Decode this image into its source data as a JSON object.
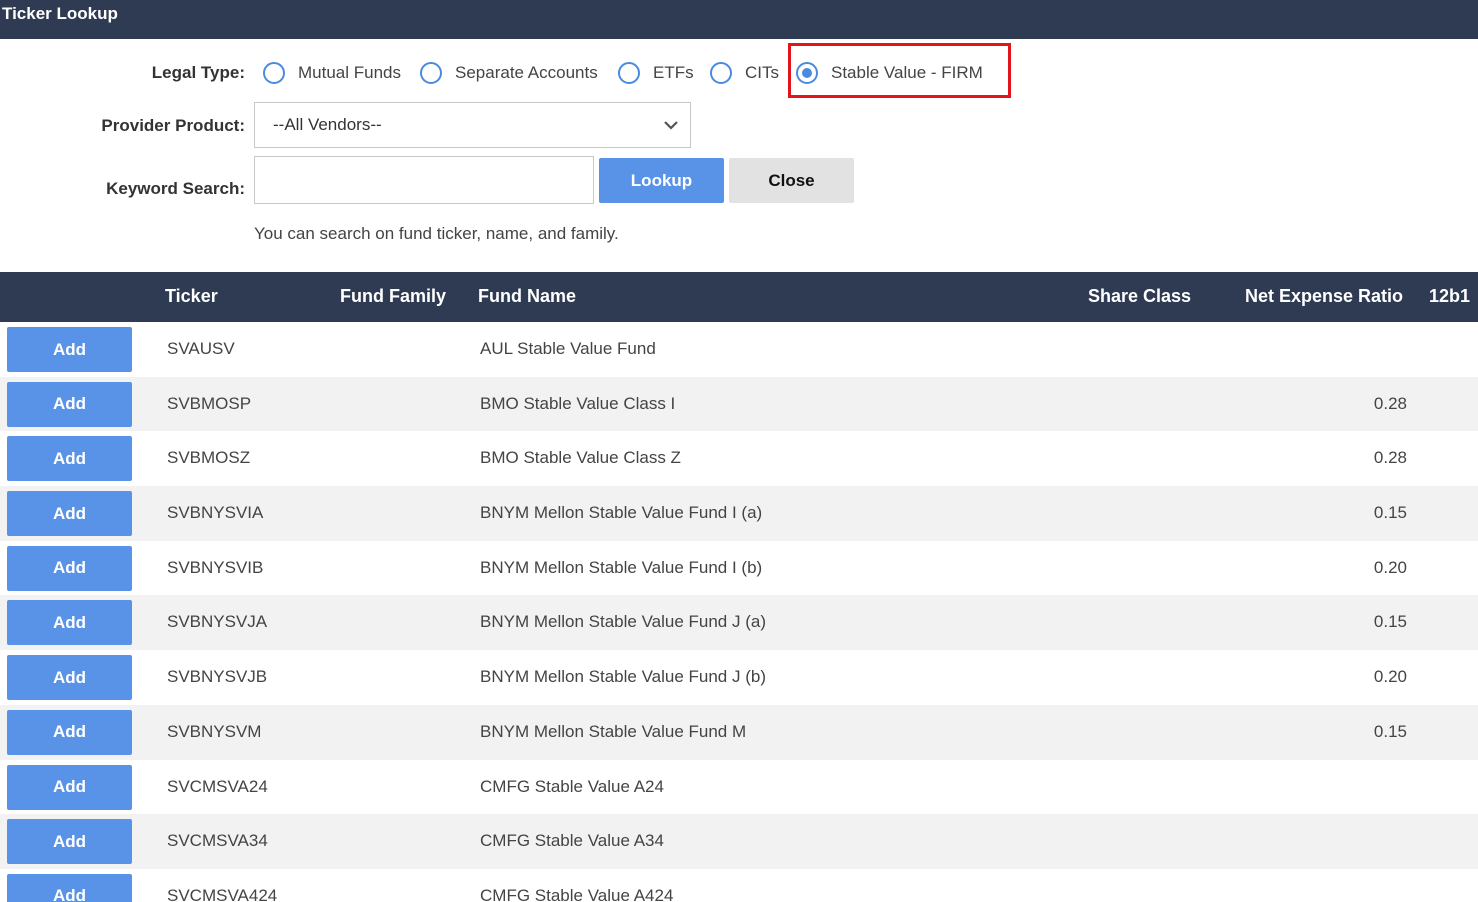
{
  "window": {
    "title": "Ticker Lookup"
  },
  "form": {
    "legal_type_label": "Legal Type:",
    "legal_types": [
      {
        "label": "Mutual Funds",
        "selected": false
      },
      {
        "label": "Separate Accounts",
        "selected": false
      },
      {
        "label": "ETFs",
        "selected": false
      },
      {
        "label": "CITs",
        "selected": false
      },
      {
        "label": "Stable Value - FIRM",
        "selected": true
      }
    ],
    "provider_label": "Provider Product:",
    "provider_value": "--All Vendors--",
    "keyword_label": "Keyword Search:",
    "keyword_value": "",
    "lookup_label": "Lookup",
    "close_label": "Close",
    "hint": "You can search on fund ticker, name, and family."
  },
  "table": {
    "columns": [
      "Ticker",
      "Fund Family",
      "Fund Name",
      "Share Class",
      "Net Expense Ratio",
      "12b1"
    ],
    "add_label": "Add",
    "rows": [
      {
        "ticker": "SVAUSV",
        "family": "",
        "name": "AUL Stable Value Fund",
        "share_class": "",
        "ratio": "",
        "b1": ""
      },
      {
        "ticker": "SVBMOSP",
        "family": "",
        "name": "BMO Stable Value Class I",
        "share_class": "",
        "ratio": "0.28",
        "b1": ""
      },
      {
        "ticker": "SVBMOSZ",
        "family": "",
        "name": "BMO Stable Value Class Z",
        "share_class": "",
        "ratio": "0.28",
        "b1": ""
      },
      {
        "ticker": "SVBNYSVIA",
        "family": "",
        "name": "BNYM Mellon Stable Value Fund I (a)",
        "share_class": "",
        "ratio": "0.15",
        "b1": ""
      },
      {
        "ticker": "SVBNYSVIB",
        "family": "",
        "name": "BNYM Mellon Stable Value Fund I (b)",
        "share_class": "",
        "ratio": "0.20",
        "b1": ""
      },
      {
        "ticker": "SVBNYSVJA",
        "family": "",
        "name": "BNYM Mellon Stable Value Fund J (a)",
        "share_class": "",
        "ratio": "0.15",
        "b1": ""
      },
      {
        "ticker": "SVBNYSVJB",
        "family": "",
        "name": "BNYM Mellon Stable Value Fund J (b)",
        "share_class": "",
        "ratio": "0.20",
        "b1": ""
      },
      {
        "ticker": "SVBNYSVM",
        "family": "",
        "name": "BNYM Mellon Stable Value Fund M",
        "share_class": "",
        "ratio": "0.15",
        "b1": ""
      },
      {
        "ticker": "SVCMSVA24",
        "family": "",
        "name": "CMFG Stable Value A24",
        "share_class": "",
        "ratio": "",
        "b1": ""
      },
      {
        "ticker": "SVCMSVA34",
        "family": "",
        "name": "CMFG Stable Value A34",
        "share_class": "",
        "ratio": "",
        "b1": ""
      },
      {
        "ticker": "SVCMSVA424",
        "family": "",
        "name": "CMFG Stable Value A424",
        "share_class": "",
        "ratio": "",
        "b1": ""
      }
    ]
  },
  "colors": {
    "header_bg": "#2e3b52",
    "primary_button": "#5893e8",
    "secondary_button": "#e2e2e2",
    "highlight_border": "#e3141b",
    "row_alt": "#f2f2f2"
  },
  "icons": {
    "select_arrow": "chevron-down-icon"
  }
}
